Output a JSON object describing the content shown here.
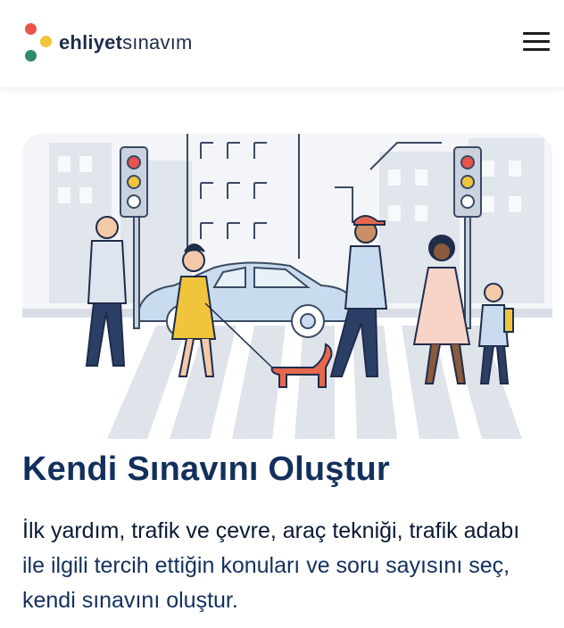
{
  "brand": {
    "name_bold": "ehliyet",
    "name_light": "sınavım",
    "dot_colors": [
      "#e8534b",
      "#f0c53c",
      "#2f8a6e"
    ]
  },
  "header": {
    "menu_icon": "hamburger-icon"
  },
  "hero": {
    "image_alt": "crosswalk-illustration"
  },
  "content": {
    "title": "Kendi Sınavını Oluştur",
    "desc_line1": "İlk yardım, trafik ve çevre, araç tekniği, trafik adabı",
    "desc_line2": "ile ilgili tercih ettiğin konuları ve soru sayısını seç,",
    "desc_line3": "kendi sınavını oluştur."
  },
  "colors": {
    "title": "#13305c",
    "text": "#13305c",
    "accent_red": "#e8534b",
    "accent_yellow": "#f0c53c",
    "accent_green": "#2f8a6e"
  }
}
